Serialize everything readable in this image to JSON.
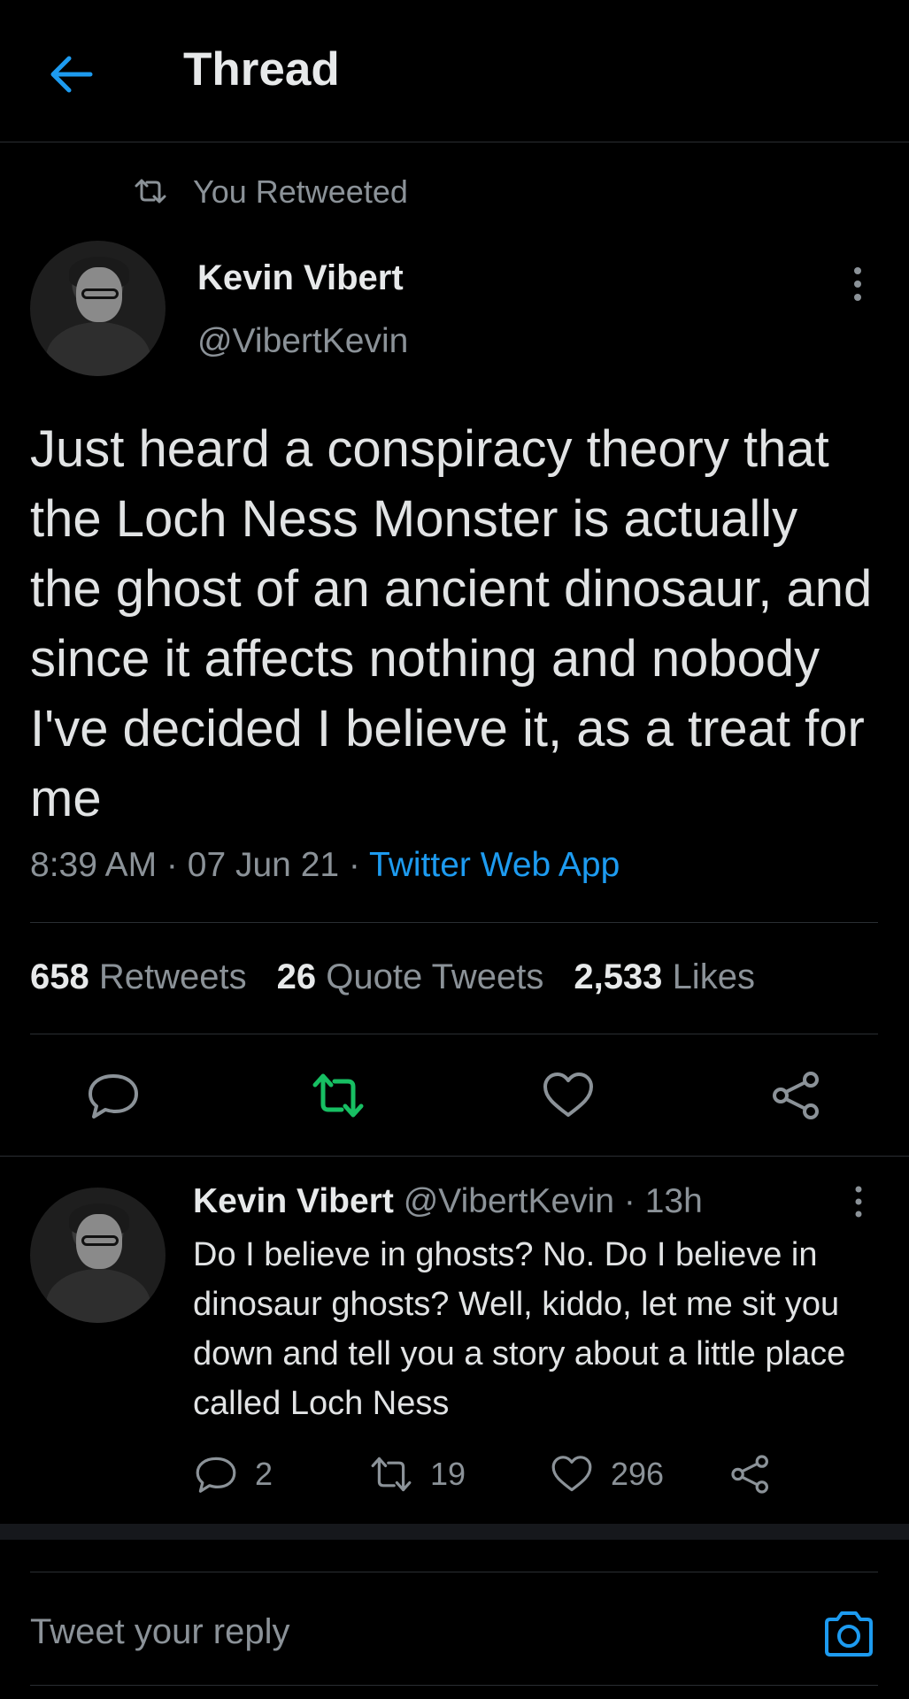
{
  "header": {
    "title": "Thread",
    "back_icon": "arrow-left-icon"
  },
  "context": {
    "label": "You Retweeted"
  },
  "main_tweet": {
    "name": "Kevin Vibert",
    "handle": "@VibertKevin",
    "text": "Just heard a conspiracy theory that the Loch Ness Monster is actually the ghost of an ancient dinosaur, and since it affects nothing and nobody I've decided I believe it, as a treat for me",
    "time": "8:39 AM",
    "sep1": " · ",
    "date": "07 Jun 21",
    "sep2": " · ",
    "source": "Twitter Web App",
    "stats": {
      "retweets_count": "658",
      "retweets_label": "Retweets",
      "quotes_count": "26",
      "quotes_label": "Quote Tweets",
      "likes_count": "2,533",
      "likes_label": "Likes"
    },
    "retweeted_color": "#17bf63"
  },
  "reply": {
    "name": "Kevin Vibert",
    "handle": "@VibertKevin",
    "dot": "·",
    "time": "13h",
    "text": "Do I believe in ghosts? No. Do I believe in dinosaur ghosts? Well, kiddo, let me sit you down and tell you a story about a little place called Loch Ness",
    "replies": "2",
    "retweets": "19",
    "likes": "296"
  },
  "compose": {
    "placeholder": "Tweet your reply"
  },
  "colors": {
    "accent": "#1d9bf0",
    "background": "#000000",
    "muted": "#8b9298"
  }
}
